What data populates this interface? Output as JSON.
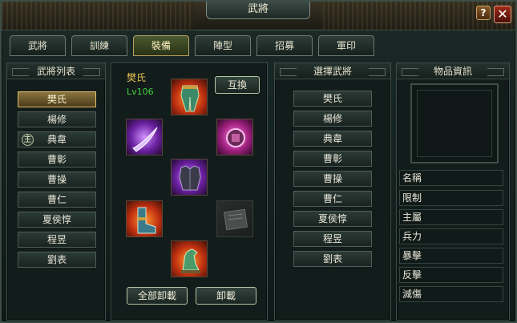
{
  "window": {
    "title": "武將"
  },
  "titlebar": {
    "help_label": "?",
    "close_label": "✕"
  },
  "tabs": [
    {
      "label": "武將"
    },
    {
      "label": "訓練"
    },
    {
      "label": "裝備"
    },
    {
      "label": "陣型"
    },
    {
      "label": "招募"
    },
    {
      "label": "軍印"
    }
  ],
  "active_tab": "裝備",
  "general_list": {
    "header": "武將列表",
    "items": [
      {
        "label": "樊氏",
        "selected": true
      },
      {
        "label": "楊修"
      },
      {
        "label": "典韋",
        "badge": "主"
      },
      {
        "label": "曹彰"
      },
      {
        "label": "曹操"
      },
      {
        "label": "曹仁"
      },
      {
        "label": "夏侯惇"
      },
      {
        "label": "程昱"
      },
      {
        "label": "劉表"
      }
    ]
  },
  "equipment": {
    "general_name": "樊氏",
    "level": "Lv106",
    "swap_button": "互換",
    "unequip_all_button": "全部卸載",
    "unequip_button": "卸載",
    "slots": [
      {
        "name": "pants",
        "state": "equipped",
        "color": "red"
      },
      {
        "name": "weapon",
        "state": "equipped",
        "color": "purple"
      },
      {
        "name": "accessory",
        "state": "equipped",
        "color": "pink"
      },
      {
        "name": "armor",
        "state": "equipped",
        "color": "purple"
      },
      {
        "name": "boots",
        "state": "equipped",
        "color": "red"
      },
      {
        "name": "book",
        "state": "empty"
      },
      {
        "name": "mount",
        "state": "equipped",
        "color": "red"
      }
    ]
  },
  "select_general": {
    "header": "選擇武將",
    "items": [
      {
        "label": "樊氏"
      },
      {
        "label": "楊修"
      },
      {
        "label": "典韋"
      },
      {
        "label": "曹彰"
      },
      {
        "label": "曹操"
      },
      {
        "label": "曹仁"
      },
      {
        "label": "夏侯惇"
      },
      {
        "label": "程昱"
      },
      {
        "label": "劉表"
      }
    ]
  },
  "item_info": {
    "header": "物品資訊",
    "rows": [
      {
        "label": "名稱"
      },
      {
        "label": "限制"
      },
      {
        "label": "主屬"
      },
      {
        "label": "兵力"
      },
      {
        "label": "暴擊"
      },
      {
        "label": "反擊"
      },
      {
        "label": "減傷"
      }
    ]
  }
}
